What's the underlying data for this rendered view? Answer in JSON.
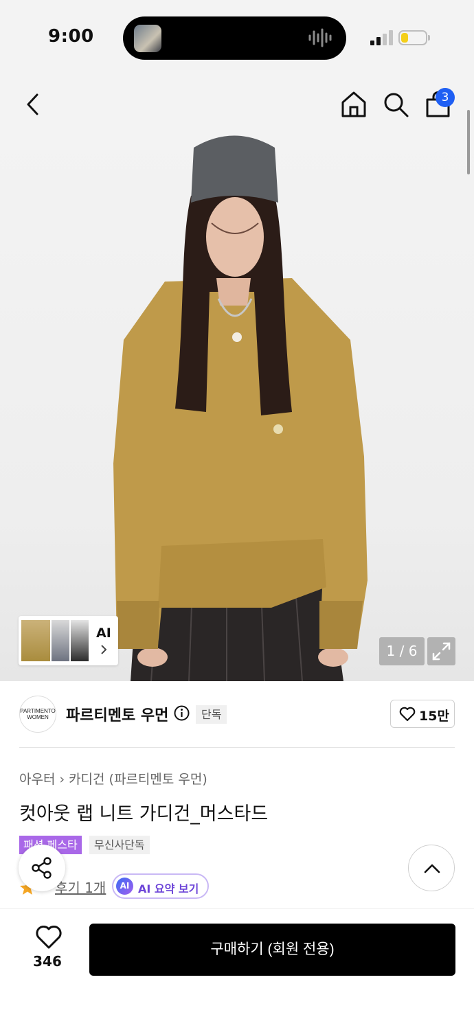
{
  "status_bar": {
    "time": "9:00",
    "battery_level": 0.3,
    "battery_color": "#f4cf1a"
  },
  "nav": {
    "back_icon": "chevron-left-icon",
    "home_icon": "home-icon",
    "search_icon": "search-icon",
    "cart_icon": "shopping-bag-icon",
    "cart_count": "3",
    "badge_color": "#1f5ff3"
  },
  "gallery": {
    "thumb_label": "AI",
    "page_indicator": "1 / 6",
    "expand_icon": "expand-icon"
  },
  "brand": {
    "logo_text": "PARTIMENTO WOMEN",
    "name": "파르티멘토 우먼",
    "exclusive_label": "단독",
    "like_count": "15만"
  },
  "product": {
    "breadcrumb": [
      "아우터",
      "카디건 (파르티멘토 우먼)"
    ],
    "title": "컷아웃 랩 니트 가디건_머스타드",
    "tags": [
      "패션 페스타",
      "무신사단독"
    ],
    "tag_festa_color": "#a968e8",
    "review_text": "후기 1개",
    "ai_summary_icon_text": "AI",
    "ai_summary_label": "AI 요약 보기"
  },
  "bottom_bar": {
    "like_count": "346",
    "buy_label": "구매하기 (회원 전용)"
  }
}
